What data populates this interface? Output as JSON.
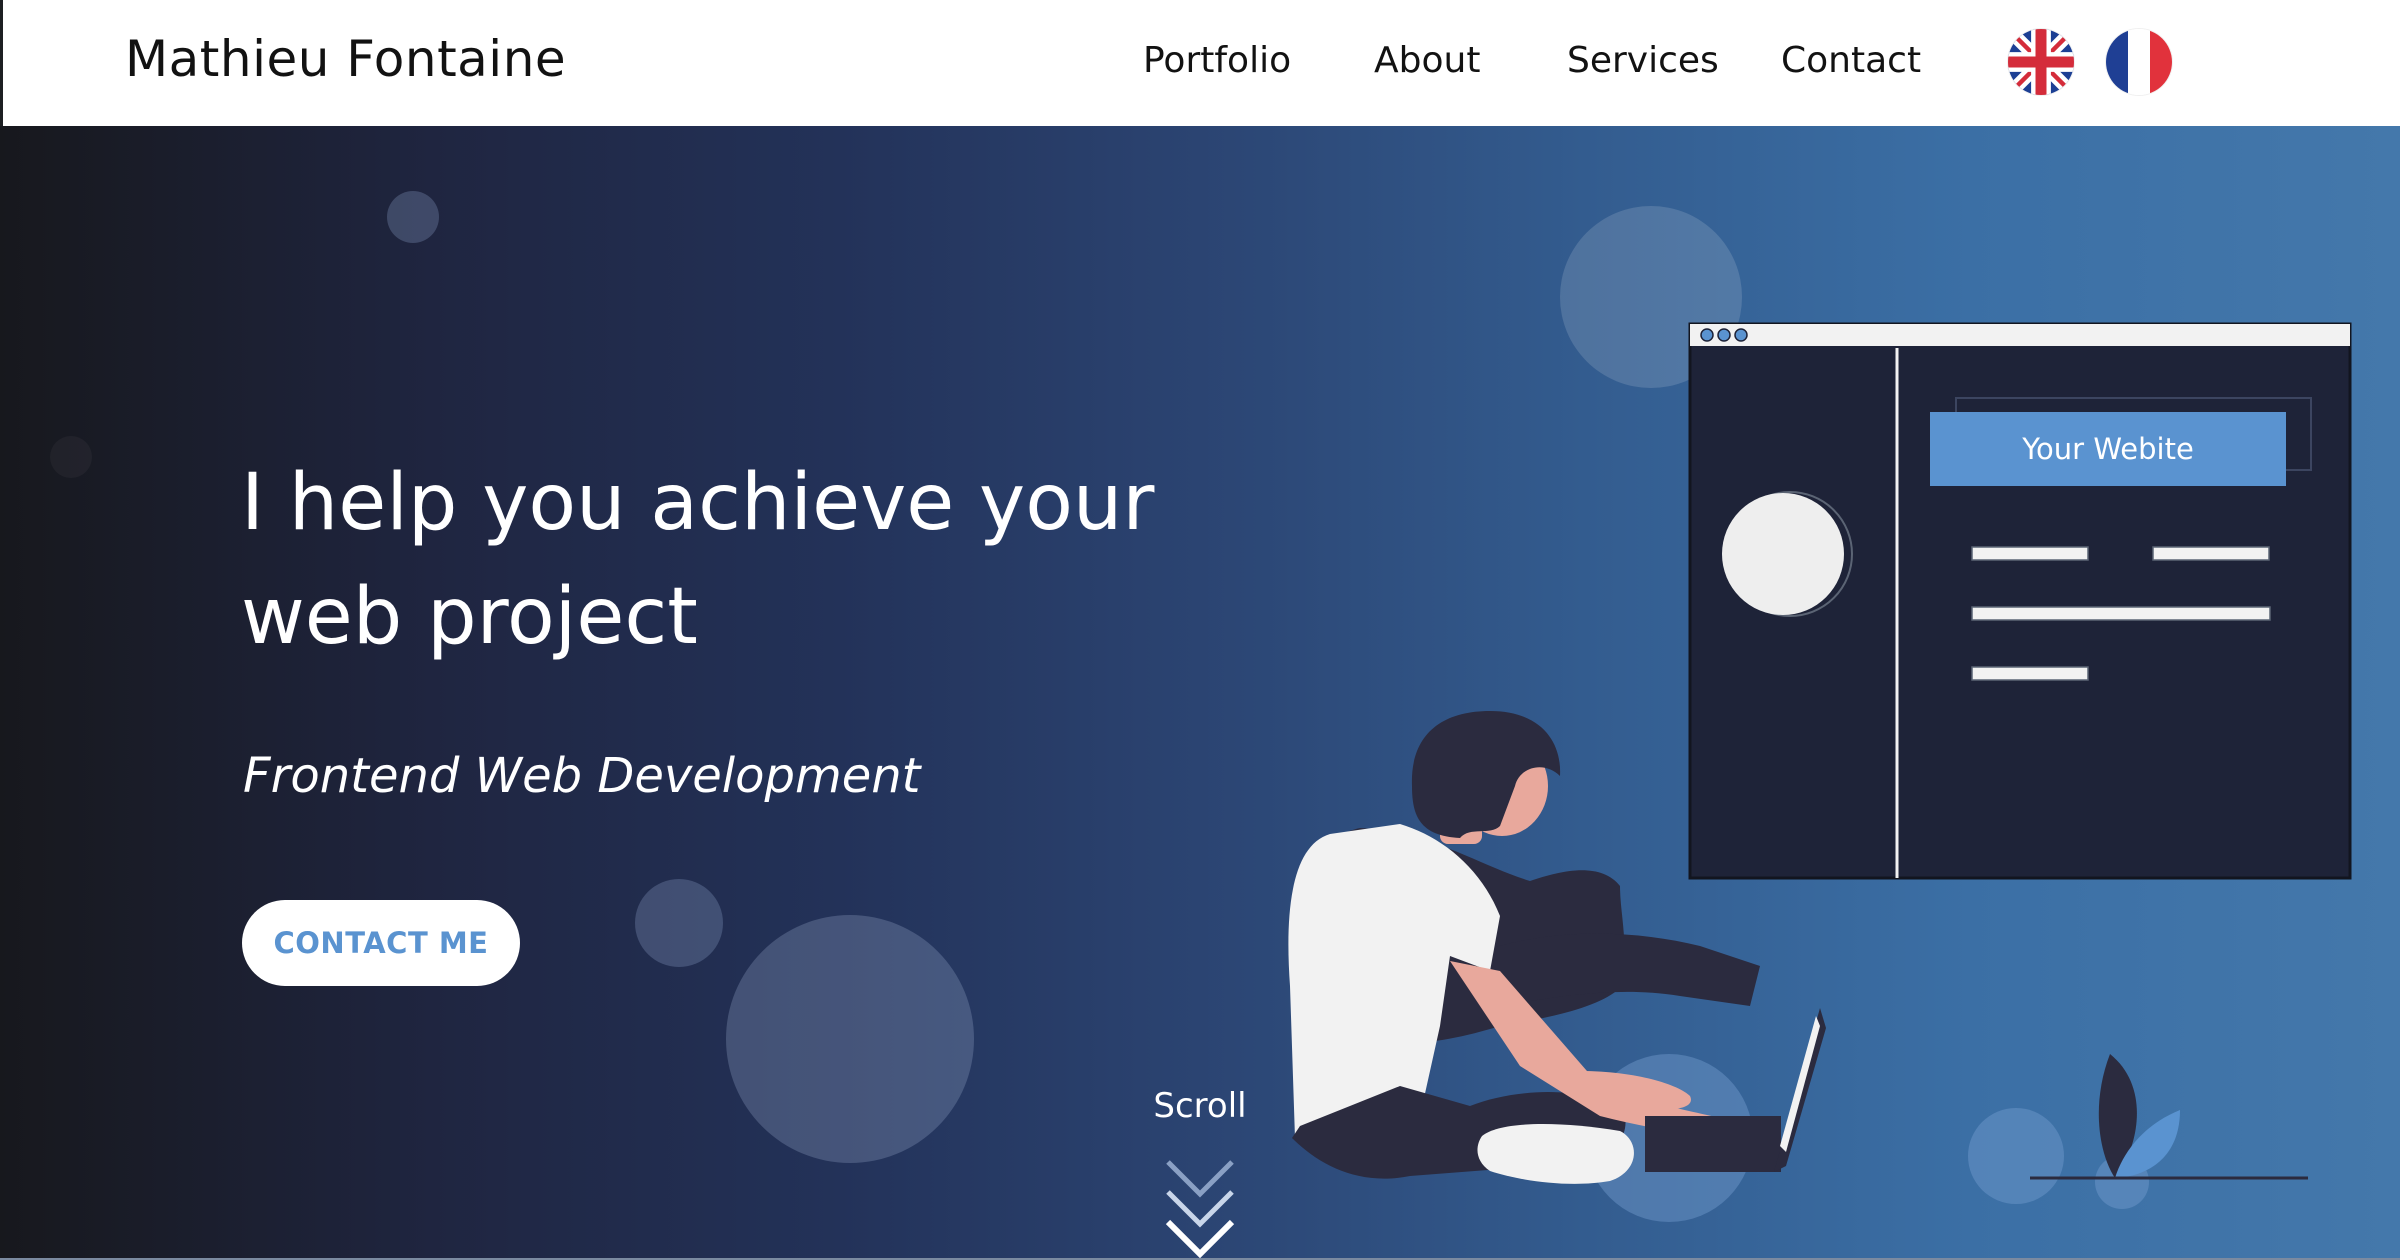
{
  "header": {
    "brand": "Mathieu Fontaine",
    "nav": {
      "portfolio": "Portfolio",
      "about": "About",
      "services": "Services",
      "contact": "Contact"
    },
    "languages": [
      {
        "icon": "uk-flag-icon",
        "code": "en"
      },
      {
        "icon": "france-flag-icon",
        "code": "fr"
      }
    ]
  },
  "hero": {
    "headline": "I help you achieve your web project",
    "subtitle": "Frontend Web Development",
    "cta_label": "CONTACT ME",
    "scroll_label": "Scroll",
    "illustration": {
      "window_button_label": "Your Webite"
    }
  },
  "colors": {
    "accent": "#5a93d0",
    "hero_gradient_start": "#17181d",
    "hero_gradient_end": "#4478ab",
    "window_bg": "#1e2338",
    "header_bg": "#ffffff"
  }
}
